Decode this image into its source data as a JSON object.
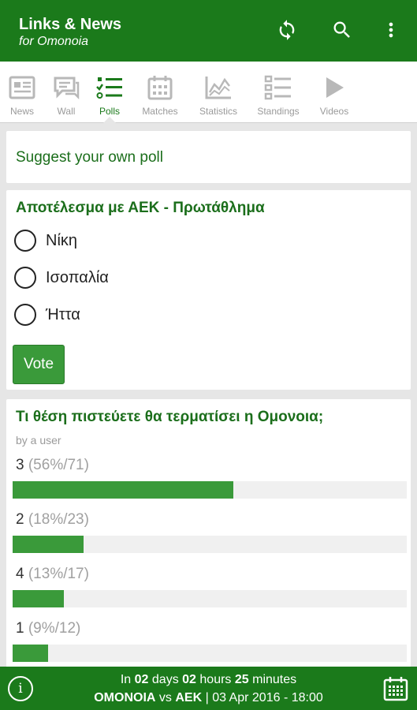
{
  "app": {
    "title": "Links & News",
    "subtitle": "for Omonoia"
  },
  "toolbar": {
    "icons": [
      "refresh-icon",
      "search-icon",
      "more-vert-icon"
    ]
  },
  "tabs": [
    {
      "label": "News",
      "icon": "news-icon",
      "active": false
    },
    {
      "label": "Wall",
      "icon": "wall-icon",
      "active": false
    },
    {
      "label": "Polls",
      "icon": "polls-icon",
      "active": true
    },
    {
      "label": "Matches",
      "icon": "calendar-icon",
      "active": false
    },
    {
      "label": "Statistics",
      "icon": "statistics-icon",
      "active": false
    },
    {
      "label": "Standings",
      "icon": "standings-icon",
      "active": false
    },
    {
      "label": "Videos",
      "icon": "play-icon",
      "active": false
    }
  ],
  "suggest": {
    "label": "Suggest your own poll"
  },
  "poll1": {
    "question": "Αποτέλεσμα με ΑΕΚ - Πρωτάθλημα",
    "options": [
      "Νίκη",
      "Ισοπαλία",
      "Ήττα"
    ],
    "vote_label": "Vote"
  },
  "poll2": {
    "question": "Τι θέση πιστεύετε θα τερματίσει η Ομονοια;",
    "author": "by a user",
    "results": [
      {
        "option": "3",
        "stats": "(56%/71)",
        "percent": 56
      },
      {
        "option": "2",
        "stats": "(18%/23)",
        "percent": 18
      },
      {
        "option": "4",
        "stats": "(13%/17)",
        "percent": 13
      },
      {
        "option": "1",
        "stats": "(9%/12)",
        "percent": 9
      }
    ]
  },
  "footer": {
    "prefix": "In",
    "days": "02",
    "days_word": "days",
    "hours": "02",
    "hours_word": "hours",
    "minutes": "25",
    "minutes_word": "minutes",
    "home": "OMONOIA",
    "vs": "vs",
    "away": "AEK",
    "datetime": "| 03 Apr 2016 - 18:00"
  },
  "colors": {
    "primary": "#1b7a1b",
    "accent": "#3a9a3a",
    "title_text": "#1b6e1b"
  }
}
